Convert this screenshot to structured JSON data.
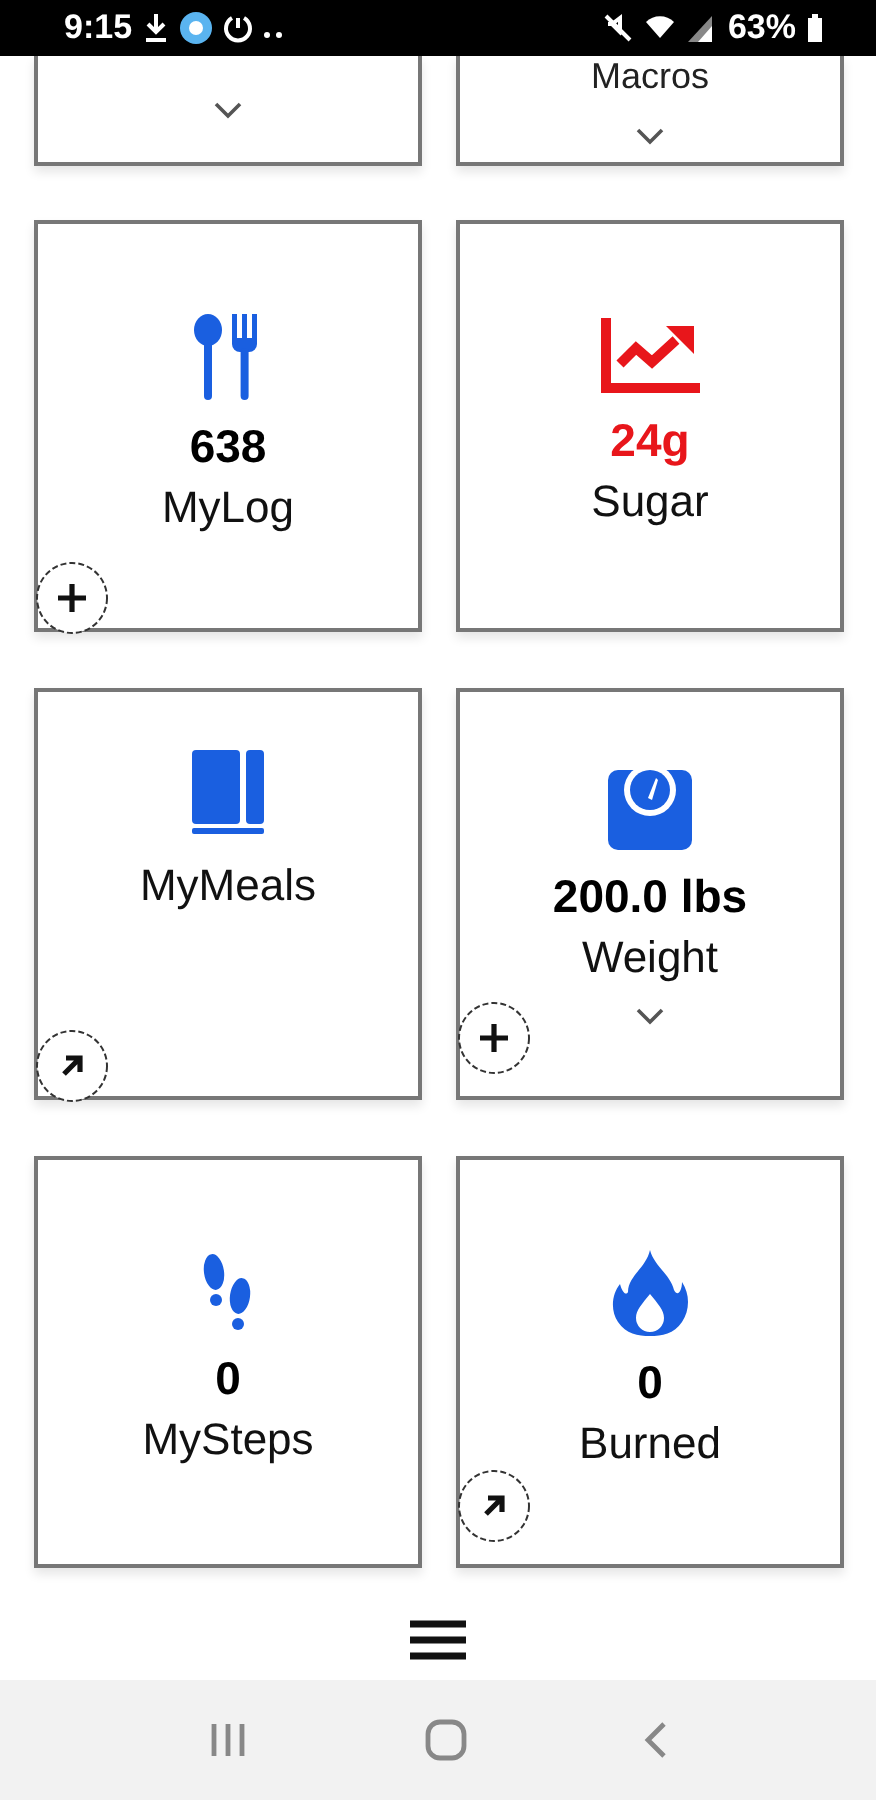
{
  "status_bar": {
    "time": "9:15",
    "battery": "63%"
  },
  "top_tiles": [
    {
      "expanded": false
    },
    {
      "label": "Macros",
      "expanded": false
    }
  ],
  "tiles": [
    {
      "kind": "utensils",
      "value": "638",
      "label": "MyLog",
      "corner_button": {
        "kind": "add"
      }
    },
    {
      "kind": "trend",
      "value": "24g",
      "label": "Sugar",
      "color": "#e8161b"
    },
    {
      "kind": "book",
      "label": "MyMeals",
      "corner_button": {
        "kind": "open"
      }
    },
    {
      "kind": "scale",
      "value": "200.0 lbs",
      "label": "Weight",
      "expanded": false,
      "corner_button": {
        "kind": "add"
      }
    },
    {
      "kind": "steps",
      "value": "0",
      "label": "MySteps"
    },
    {
      "kind": "flame",
      "value": "0",
      "label": "Burned",
      "corner_button": {
        "kind": "open"
      }
    }
  ]
}
